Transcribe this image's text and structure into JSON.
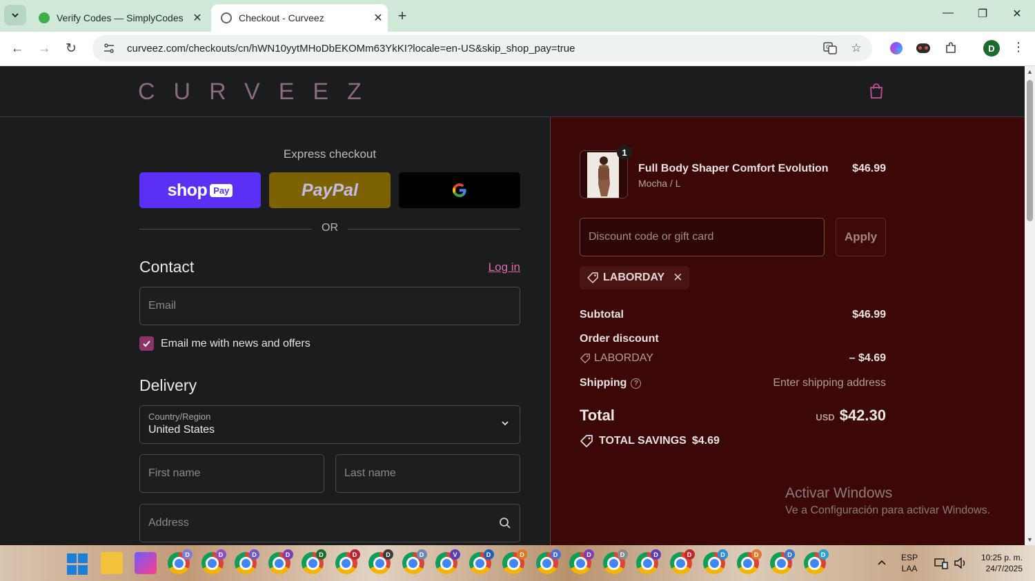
{
  "browser": {
    "tabs": [
      {
        "title": "Verify Codes — SimplyCodes",
        "active": false
      },
      {
        "title": "Checkout - Curveez",
        "active": true
      }
    ],
    "url": "curveez.com/checkouts/cn/hWN10yytMHoDbEKOMm63YkKI?locale=en-US&skip_shop_pay=true",
    "profile_initial": "D"
  },
  "header": {
    "logo": "CURVEEZ"
  },
  "express": {
    "title": "Express checkout",
    "shop_pay_word": "shop",
    "shop_pay_badge": "Pay",
    "paypal_word": "PayPal",
    "or_label": "OR"
  },
  "contact": {
    "title": "Contact",
    "login_label": "Log in",
    "email_placeholder": "Email",
    "newsletter_label": "Email me with news and offers",
    "newsletter_checked": true
  },
  "delivery": {
    "title": "Delivery",
    "country_label": "Country/Region",
    "country_value": "United States",
    "first_name_placeholder": "First name",
    "last_name_placeholder": "Last name",
    "address_placeholder": "Address"
  },
  "summary": {
    "item": {
      "quantity": "1",
      "name": "Full Body Shaper Comfort Evolution",
      "variant": "Mocha / L",
      "price": "$46.99"
    },
    "discount_placeholder": "Discount code or gift card",
    "apply_label": "Apply",
    "applied_code": "LABORDAY",
    "subtotal_label": "Subtotal",
    "subtotal_value": "$46.99",
    "order_discount_label": "Order discount",
    "discount_code": "LABORDAY",
    "discount_value": "– $4.69",
    "shipping_label": "Shipping",
    "shipping_value": "Enter shipping address",
    "total_label": "Total",
    "total_currency": "USD",
    "total_value": "$42.30",
    "savings_label": "TOTAL SAVINGS",
    "savings_value": "$4.69"
  },
  "windows_watermark": {
    "line1": "Activar Windows",
    "line2": "Ve a Configuración para activar Windows."
  },
  "taskbar": {
    "lang_top": "ESP",
    "lang_bottom": "LAA",
    "time": "10:25 p. m.",
    "date": "24/7/2025",
    "chrome_badges": [
      "D",
      "D",
      "D",
      "D",
      "D",
      "D",
      "D",
      "D",
      "V",
      "D",
      "D",
      "D",
      "D",
      "D",
      "D",
      "D",
      "D",
      "D",
      "D",
      "D"
    ]
  },
  "colors": {
    "accent": "#8c3468",
    "link": "#e06ba3",
    "summary_bg": "#3b0807",
    "shop_pay": "#5a31f4",
    "paypal": "#7d6204",
    "gpay": "#000000"
  }
}
